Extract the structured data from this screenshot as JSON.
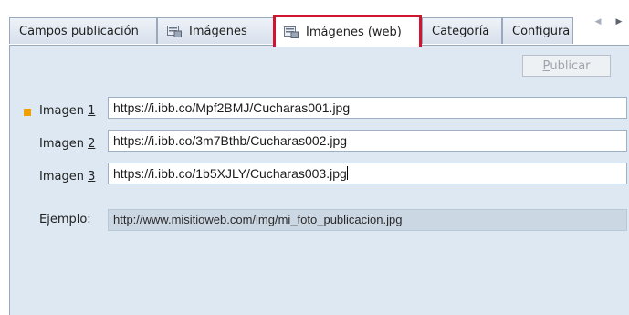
{
  "tabs": [
    {
      "label": "Campos publicación",
      "icon": null,
      "active": false
    },
    {
      "label": "Imágenes",
      "icon": "image-icon",
      "active": false
    },
    {
      "label": "Imágenes (web)",
      "icon": "web-image-icon",
      "active": true
    },
    {
      "label": "Categoría",
      "icon": null,
      "active": false
    },
    {
      "label": "Configura",
      "icon": null,
      "active": false
    }
  ],
  "tab_scroll": {
    "left": "◀",
    "right": "▶"
  },
  "panel": {
    "publish_button": {
      "label_pre": "",
      "mnemonic": "P",
      "label_post": "ublicar",
      "enabled": false
    },
    "images": [
      {
        "label_pre": "Imagen ",
        "mnemonic": "1",
        "value": "https://i.ibb.co/Mpf2BMJ/Cucharas001.jpg",
        "required": true
      },
      {
        "label_pre": "Imagen ",
        "mnemonic": "2",
        "value": "https://i.ibb.co/3m7Bthb/Cucharas002.jpg",
        "required": false
      },
      {
        "label_pre": "Imagen ",
        "mnemonic": "3",
        "value": "https://i.ibb.co/1b5XJLY/Cucharas003.jpg",
        "required": false
      }
    ],
    "example": {
      "label": "Ejemplo:",
      "value": "http://www.misitioweb.com/img/mi_foto_publicacion.jpg"
    }
  },
  "colors": {
    "active_tab_outline": "#d0162f",
    "panel_bg": "#dde8f3",
    "required_marker": "#f0a000"
  }
}
